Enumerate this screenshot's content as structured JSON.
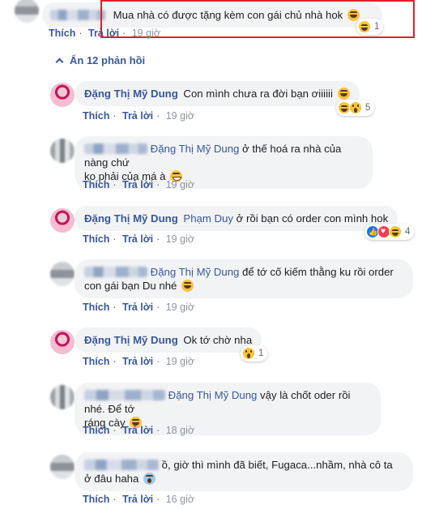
{
  "top_comment": {
    "text": "Mua nhà có được tặng kèm con gái chủ nhà hok",
    "reaction_count": "1",
    "actions": {
      "like": "Thích",
      "reply": "Trả lời",
      "time": "19 giờ"
    }
  },
  "toggle_replies": "Ẩn 12 phản hồi",
  "replies": [
    {
      "name": "Đặng Thị Mỹ Dung",
      "text": "Con mình chưa ra đời bạn ơiiiiii",
      "reaction_count": "5",
      "time": "19 giờ"
    },
    {
      "mention": "Đặng Thị Mỹ Dung",
      "text_line1": " ở thế hoá ra nhà của nàng chứ",
      "text_line2": "ko phải của má à",
      "time": "19 giờ"
    },
    {
      "name": "Đặng Thị Mỹ Dung",
      "mention": "Phạm Duy",
      "text": " ở rồi bạn có order con mình hok",
      "reaction_count": "4",
      "time": "19 giờ"
    },
    {
      "mention": "Đặng Thị Mỹ Dung",
      "text_line1": " để tớ cố kiếm thằng ku rồi order",
      "text_line2": "con gái bạn Du nhé",
      "time": "19 giờ"
    },
    {
      "name": "Đặng Thị Mỹ Dung",
      "text": "Ok tớ chờ nha",
      "reaction_count": "1",
      "time": "19 giờ"
    },
    {
      "mention": "Đặng Thị Mỹ Dung",
      "text_line1": " vậy là chốt oder rồi nhé. Để tớ",
      "text_line2": "ráng cày",
      "time": "18 giờ"
    },
    {
      "text_line1": "ồ, giờ thì mình đã biết, Fugaca...nhầm, nhà cô ta",
      "text_line2": "ở đâu haha",
      "time": "16 giờ"
    }
  ],
  "labels": {
    "like": "Thích",
    "reply": "Trả lời",
    "dot": "·"
  },
  "colors": {
    "link": "#385898",
    "highlight": "#e0202a",
    "bubble": "#f2f3f5"
  }
}
